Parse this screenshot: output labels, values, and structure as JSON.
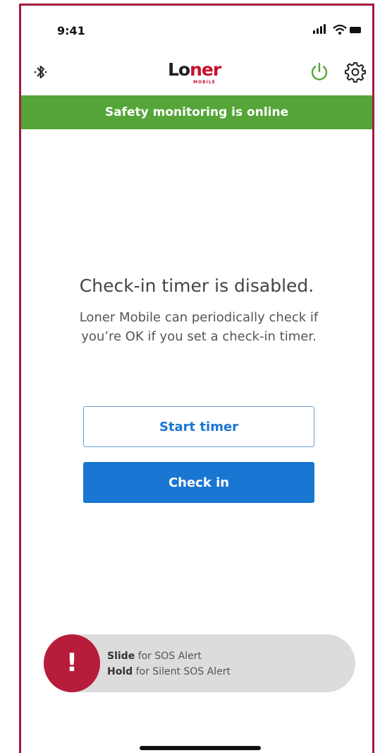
{
  "status_bar": {
    "time": "9:41"
  },
  "header": {
    "logo_primary": "Lo",
    "logo_accent": "ner",
    "logo_sub": "MOBILE",
    "bluetooth_icon": "bluetooth-icon",
    "power_icon": "power-icon",
    "settings_icon": "gear-icon"
  },
  "banner": {
    "text": "Safety monitoring is online"
  },
  "main": {
    "title": "Check-in timer is disabled.",
    "description": "Loner Mobile can periodically check if you’re OK if you set a check-in timer.",
    "start_timer_label": "Start timer",
    "check_in_label": "Check in"
  },
  "sos": {
    "slide_action": "Slide",
    "slide_text": " for SOS Alert",
    "hold_action": "Hold",
    "hold_text": " for Silent SOS Alert",
    "knob_symbol": "!"
  },
  "colors": {
    "brand_red": "#b71c3a",
    "banner_green": "#55a538",
    "primary_blue": "#1976d2"
  }
}
